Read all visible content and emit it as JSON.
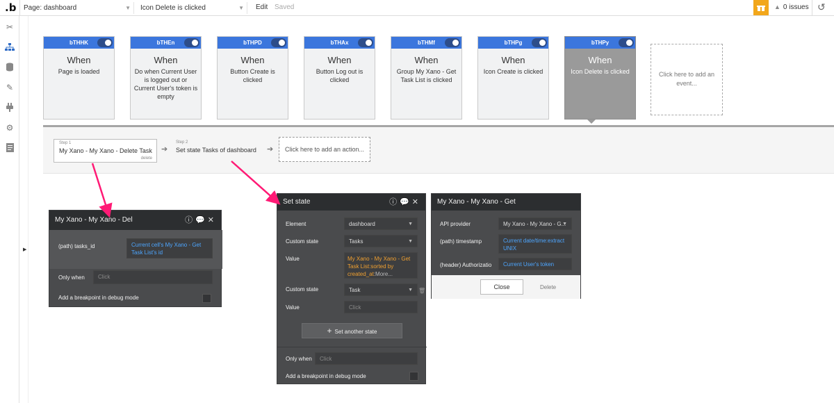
{
  "topbar": {
    "logo": ".b",
    "page_select": "Page: dashboard",
    "event_select": "Icon Delete is clicked",
    "edit": "Edit",
    "saved": "Saved",
    "gift_icon": "gift-icon",
    "issues": "0 issues"
  },
  "sidebar": {
    "icons": [
      "design-icon",
      "workflow-icon",
      "data-icon",
      "styles-icon",
      "plugins-icon",
      "settings-icon",
      "logs-icon"
    ]
  },
  "events": [
    {
      "id": "bTHHK",
      "when": "When",
      "desc": "Page is loaded",
      "selected": false
    },
    {
      "id": "bTHEn",
      "when": "When",
      "desc": "Do when Current User is logged out or Current User's token is empty",
      "selected": false
    },
    {
      "id": "bTHPD",
      "when": "When",
      "desc": "Button Create is clicked",
      "selected": false
    },
    {
      "id": "bTHAx",
      "when": "When",
      "desc": "Button Log out is clicked",
      "selected": false
    },
    {
      "id": "bTHMf",
      "when": "When",
      "desc": "Group My Xano - Get Task List is clicked",
      "selected": false
    },
    {
      "id": "bTHPg",
      "when": "When",
      "desc": "Icon Create is clicked",
      "selected": false
    },
    {
      "id": "bTHPy",
      "when": "When",
      "desc": "Icon Delete is clicked",
      "selected": true
    }
  ],
  "add_event": "Click here to add an event...",
  "steps": {
    "step1_label": "Step 1",
    "step1_title": "My Xano - My Xano - Delete Task",
    "step1_delete": "delete",
    "step2_label": "Step 2",
    "step2_title": "Set state Tasks of dashboard",
    "add_action": "Click here to add an action..."
  },
  "panel_delete": {
    "title": "My Xano - My Xano - Del",
    "path_label": "(path) tasks_id",
    "path_value": "Current cell's My Xano - Get Task List's id",
    "only_when_label": "Only when",
    "only_when_placeholder": "Click",
    "breakpoint_label": "Add a breakpoint in debug mode"
  },
  "panel_setstate": {
    "title": "Set state",
    "element_label": "Element",
    "element_value": "dashboard",
    "custom_state_label": "Custom state",
    "custom_state_value": "Tasks",
    "value_label": "Value",
    "value_value": "My Xano - My Xano - Get Task List:sorted by created_at",
    "value_more": ":More...",
    "custom_state2_label": "Custom state",
    "custom_state2_value": "Task",
    "value2_label": "Value",
    "value2_placeholder": "Click",
    "set_another": "Set another state",
    "only_when_label": "Only when",
    "only_when_placeholder": "Click",
    "breakpoint_label": "Add a breakpoint in debug mode"
  },
  "panel_get": {
    "title": "My Xano - My Xano - Get",
    "api_label": "API provider",
    "api_value": "My Xano - My Xano - G...",
    "timestamp_label": "(path) timestamp",
    "timestamp_value": "Current date/time:extract UNIX",
    "auth_label": "(header) Authorizatio",
    "auth_value": "Current User's token",
    "close": "Close",
    "delete": "Delete"
  },
  "colors": {
    "event_header": "#3b76dd",
    "panel_bg": "#4a4b4d",
    "panel_head": "#2c2e30",
    "dynamic_text": "#4da6ff",
    "annotation_arrow": "#ff1a75",
    "gift": "#f2a71b"
  }
}
